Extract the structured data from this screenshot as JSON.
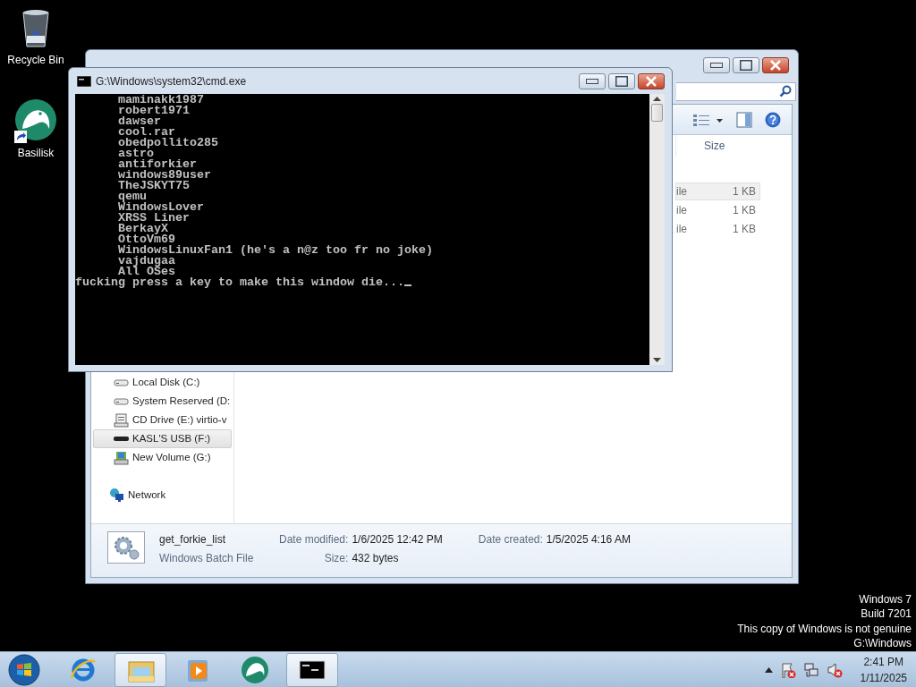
{
  "desktop_icons": [
    {
      "label": "Recycle Bin",
      "kind": "recycle"
    },
    {
      "label": "Basilisk",
      "kind": "basilisk"
    }
  ],
  "explorer": {
    "columns": [
      "Size"
    ],
    "files": [
      {
        "type": "ile",
        "size": "1 KB",
        "selected": true
      },
      {
        "type": "ile",
        "size": "1 KB",
        "selected": false
      },
      {
        "type": "ile",
        "size": "1 KB",
        "selected": false
      }
    ],
    "nav": [
      {
        "label": "Local Disk (C:)",
        "kind": "disk",
        "selected": false
      },
      {
        "label": "System Reserved (D:",
        "kind": "disk",
        "selected": false
      },
      {
        "label": "CD Drive (E:) virtio-v",
        "kind": "cd",
        "selected": false
      },
      {
        "label": "KASL'S USB (F:)",
        "kind": "usb",
        "selected": true
      },
      {
        "label": "New Volume (G:)",
        "kind": "volume",
        "selected": false
      }
    ],
    "network": "Network",
    "details": {
      "name": "get_forkie_list",
      "type": "Windows Batch File",
      "fields": [
        {
          "label": "Date modified:",
          "value": "1/6/2025 12:42 PM"
        },
        {
          "label": "Size:",
          "value": "432 bytes"
        },
        {
          "label": "Date created:",
          "value": "1/5/2025 4:16 AM"
        }
      ]
    }
  },
  "console": {
    "title": "G:\\Windows\\system32\\cmd.exe",
    "lines": [
      "maminakk1987",
      "robert1971",
      "dawser",
      "cool.rar",
      "obedpollito285",
      "astro",
      "antiforkier",
      "windows89user",
      "TheJSKYT75",
      "qemu",
      "WindowsLover",
      "XRSS Liner",
      "BerkayX",
      "OttoVm69",
      "WindowsLinuxFan1 (he's a n@z too fr no joke)",
      "vajdugaa",
      "All OSes"
    ],
    "prompt": "fucking press a key to make this window die..."
  },
  "desktop_notice": [
    "Windows 7",
    "Build 7201",
    "This copy of Windows is not genuine",
    "G:\\Windows"
  ],
  "taskbar": {
    "apps": [
      {
        "kind": "ie",
        "running": false
      },
      {
        "kind": "explorer",
        "running": true
      },
      {
        "kind": "media",
        "running": false
      },
      {
        "kind": "basilisk",
        "running": false
      },
      {
        "kind": "console",
        "running": true
      }
    ],
    "clock": {
      "time": "2:41 PM",
      "date": "1/11/2025"
    }
  }
}
